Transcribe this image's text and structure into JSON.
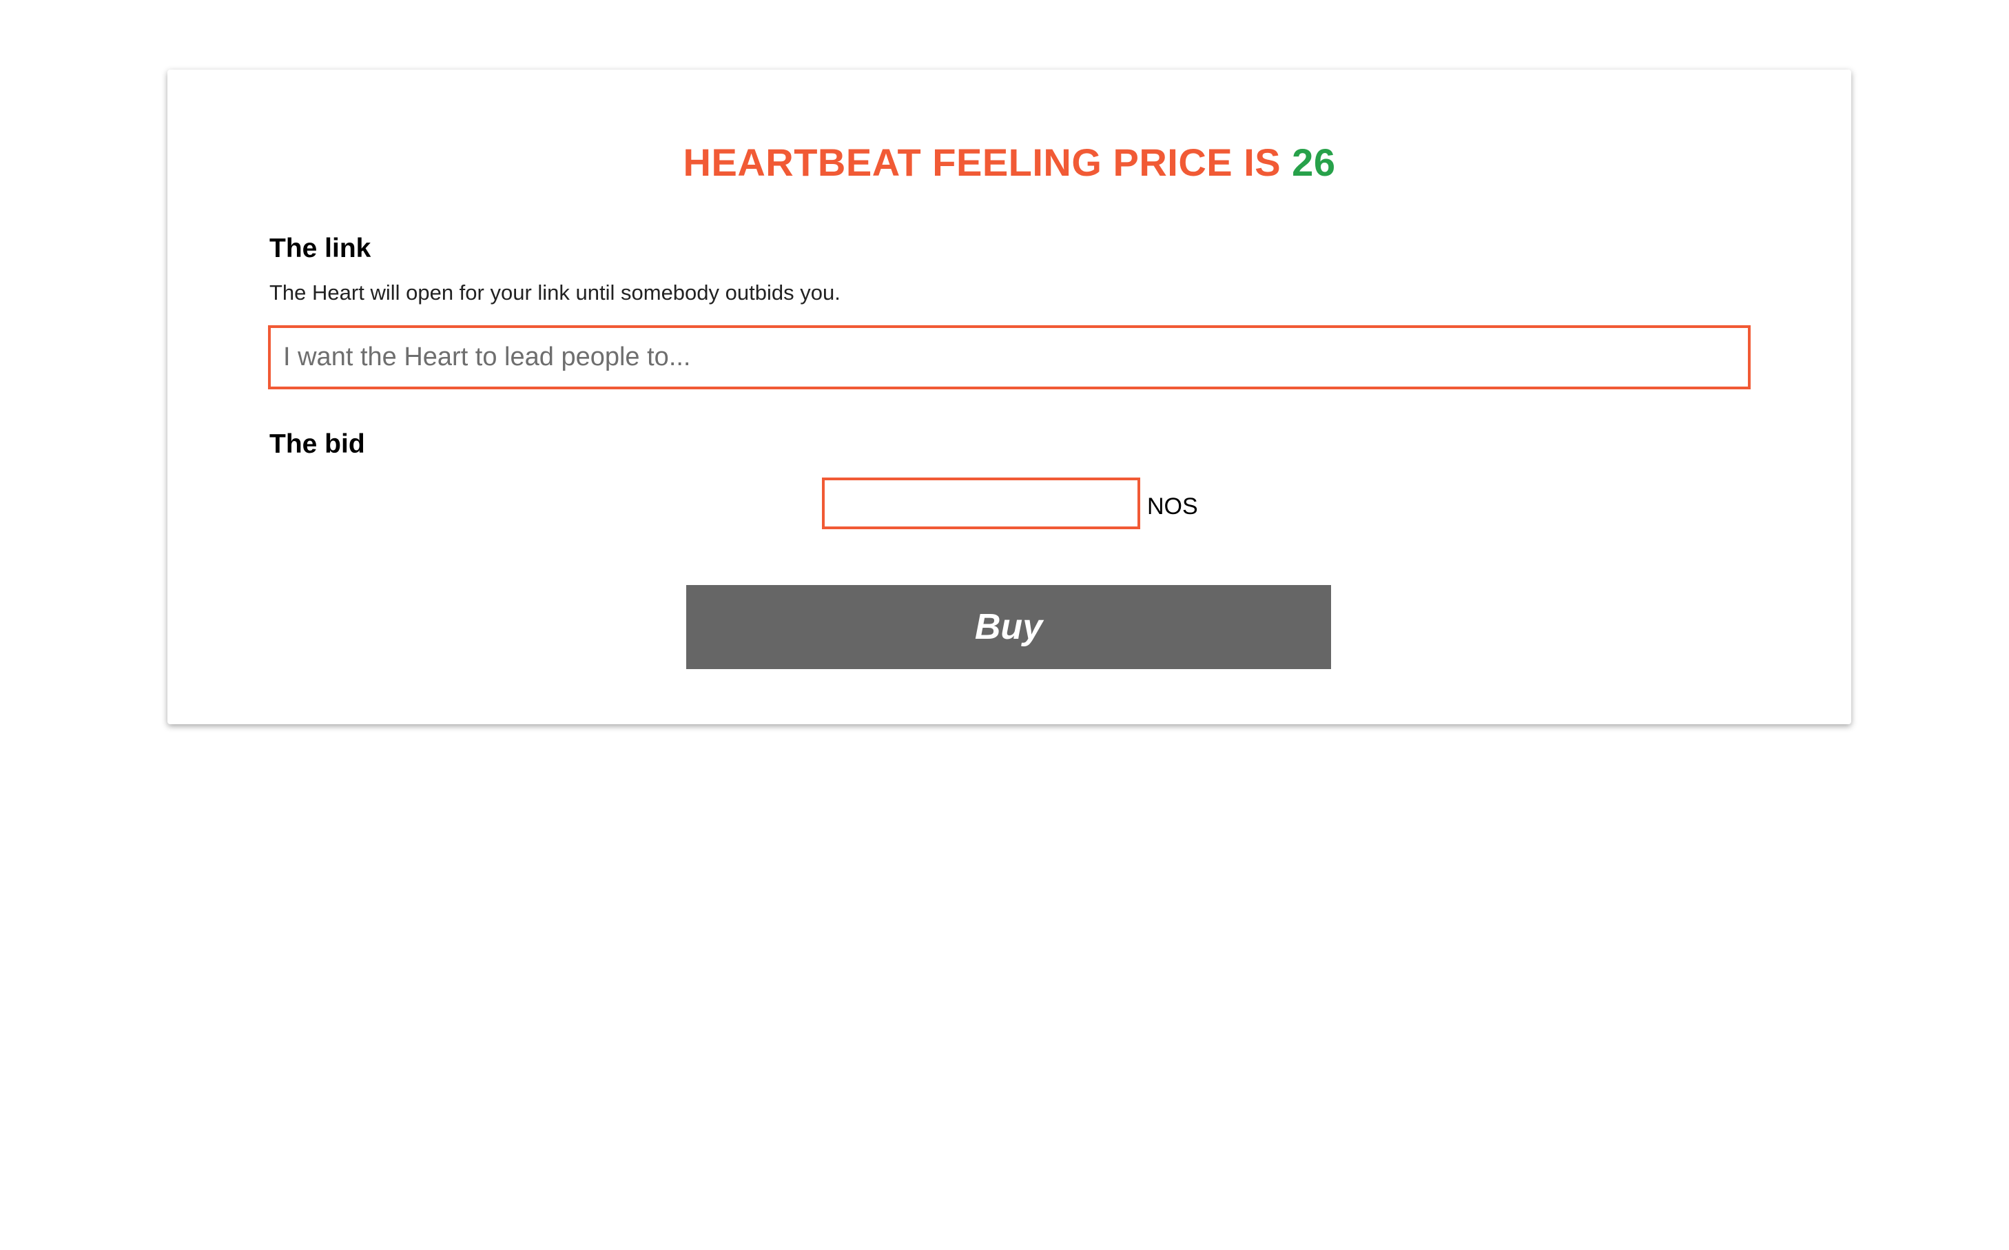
{
  "header": {
    "title_prefix": "HEARTBEAT FEELING PRICE IS",
    "price": "26"
  },
  "link_section": {
    "label": "The link",
    "helper": "The Heart will open for your link until somebody outbids you.",
    "input_placeholder": "I want the Heart to lead people to...",
    "input_value": ""
  },
  "bid_section": {
    "label": "The bid",
    "input_value": "",
    "currency": "NOS"
  },
  "actions": {
    "buy_label": "Buy"
  },
  "colors": {
    "accent": "#f15a35",
    "price": "#27a14a",
    "button_bg": "#666666"
  }
}
